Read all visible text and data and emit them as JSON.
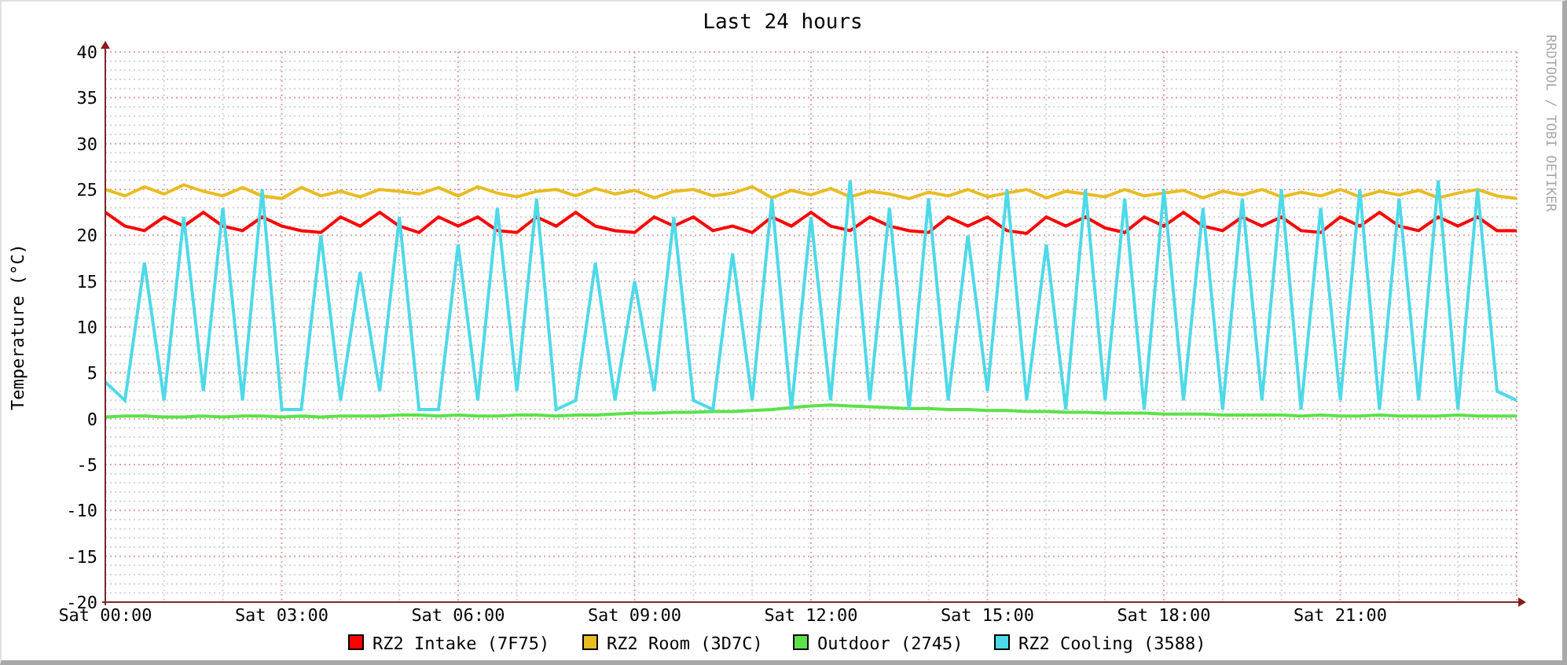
{
  "chart_data": {
    "type": "line",
    "title": "Last 24 hours",
    "ylabel": "Temperature (°C)",
    "ylim": [
      -20,
      40
    ],
    "grid": true,
    "legend": true,
    "categories": [
      "Sat 00:00",
      null,
      null,
      null,
      null,
      null,
      null,
      null,
      null,
      "Sat 03:00",
      null,
      null,
      null,
      null,
      null,
      null,
      null,
      null,
      "Sat 06:00",
      null,
      null,
      null,
      null,
      null,
      null,
      null,
      null,
      "Sat 09:00",
      null,
      null,
      null,
      null,
      null,
      null,
      null,
      null,
      "Sat 12:00",
      null,
      null,
      null,
      null,
      null,
      null,
      null,
      null,
      "Sat 15:00",
      null,
      null,
      null,
      null,
      null,
      null,
      null,
      null,
      "Sat 18:00",
      null,
      null,
      null,
      null,
      null,
      null,
      null,
      null,
      "Sat 21:00",
      null,
      null,
      null,
      null,
      null,
      null,
      null,
      null,
      null
    ],
    "yticks": [
      -20,
      -15,
      -10,
      -5,
      0,
      5,
      10,
      15,
      20,
      25,
      30,
      35,
      40
    ],
    "series": [
      {
        "name": "RZ2 Intake (7F75)",
        "color": "#ff0000",
        "values": [
          22.5,
          21,
          20.5,
          22,
          21,
          22.5,
          21,
          20.5,
          22,
          21,
          20.5,
          20.3,
          22,
          21,
          22.5,
          21,
          20.3,
          22,
          21,
          22,
          20.5,
          20.3,
          22,
          21,
          22.5,
          21,
          20.5,
          20.3,
          22,
          21,
          22,
          20.5,
          21,
          20.3,
          22,
          21,
          22.5,
          21,
          20.5,
          22,
          21,
          20.5,
          20.3,
          22,
          21,
          22,
          20.5,
          20.2,
          22,
          21,
          22,
          20.8,
          20.3,
          22,
          21,
          22.5,
          21,
          20.5,
          22,
          21,
          22,
          20.5,
          20.3,
          22,
          21,
          22.5,
          21,
          20.5,
          22,
          21,
          22,
          20.5,
          20.5
        ]
      },
      {
        "name": "RZ2 Room (3D7C)",
        "color": "#e8bc22",
        "values": [
          25,
          24.3,
          25.3,
          24.5,
          25.5,
          24.8,
          24.3,
          25.2,
          24.3,
          24,
          25.2,
          24.3,
          24.8,
          24.2,
          25,
          24.8,
          24.5,
          25.2,
          24.3,
          25.3,
          24.6,
          24.2,
          24.8,
          25,
          24.3,
          25.1,
          24.5,
          24.9,
          24.1,
          24.8,
          25,
          24.3,
          24.6,
          25.3,
          24.1,
          24.9,
          24.4,
          25.1,
          24.2,
          24.8,
          24.5,
          24,
          24.7,
          24.3,
          25,
          24.2,
          24.6,
          25,
          24.1,
          24.8,
          24.5,
          24.2,
          25,
          24.3,
          24.6,
          24.9,
          24.1,
          24.8,
          24.4,
          25,
          24.2,
          24.7,
          24.3,
          25,
          24.2,
          24.8,
          24.4,
          24.9,
          24.1,
          24.6,
          25,
          24.3,
          24
        ]
      },
      {
        "name": "Outdoor (2745)",
        "color": "#5ce14a",
        "values": [
          0.2,
          0.3,
          0.3,
          0.2,
          0.2,
          0.3,
          0.2,
          0.3,
          0.3,
          0.2,
          0.3,
          0.2,
          0.3,
          0.3,
          0.3,
          0.4,
          0.4,
          0.3,
          0.4,
          0.3,
          0.3,
          0.4,
          0.4,
          0.3,
          0.4,
          0.4,
          0.5,
          0.6,
          0.6,
          0.7,
          0.7,
          0.8,
          0.8,
          0.9,
          1,
          1.2,
          1.4,
          1.5,
          1.4,
          1.3,
          1.2,
          1.1,
          1.1,
          1,
          1,
          0.9,
          0.9,
          0.8,
          0.8,
          0.7,
          0.7,
          0.6,
          0.6,
          0.6,
          0.5,
          0.5,
          0.5,
          0.4,
          0.4,
          0.4,
          0.4,
          0.3,
          0.4,
          0.3,
          0.3,
          0.4,
          0.3,
          0.3,
          0.3,
          0.4,
          0.3,
          0.3,
          0.3
        ]
      },
      {
        "name": "RZ2 Cooling (3588)",
        "color": "#4ed9e8",
        "values": [
          4,
          2,
          17,
          2,
          22,
          3,
          23,
          2,
          25,
          1,
          1,
          20,
          2,
          16,
          3,
          22,
          1,
          1,
          19,
          2,
          23,
          3,
          24,
          1,
          2,
          17,
          2,
          15,
          3,
          22,
          2,
          1,
          18,
          2,
          24,
          1,
          22,
          2,
          26,
          2,
          23,
          1,
          24,
          2,
          20,
          3,
          25,
          2,
          19,
          1,
          25,
          2,
          24,
          1,
          25,
          2,
          23,
          1,
          24,
          2,
          25,
          1,
          23,
          2,
          25,
          1,
          24,
          2,
          26,
          1,
          25,
          3,
          2
        ]
      }
    ]
  },
  "credit": "RRDTOOL / TOBI OETIKER"
}
